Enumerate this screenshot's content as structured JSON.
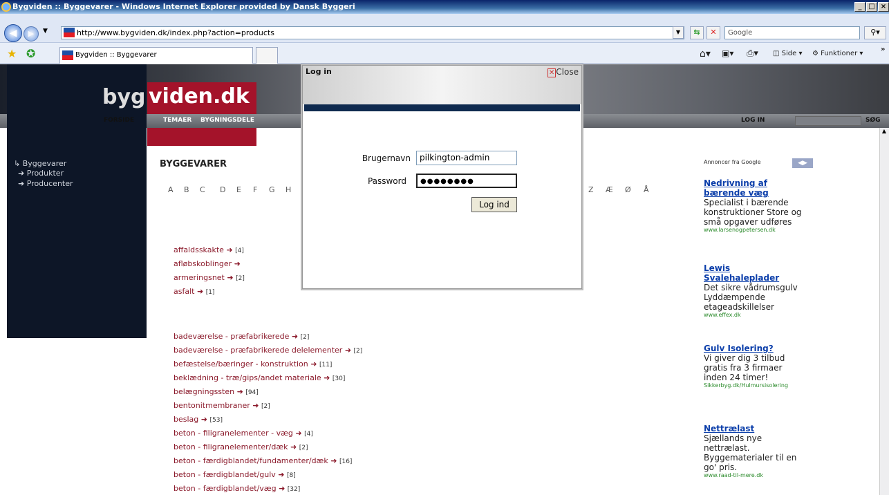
{
  "window": {
    "title": "Bygviden :: Byggevarer - Windows Internet Explorer provided by Dansk Byggeri",
    "min": "_",
    "max": "□",
    "close": "×"
  },
  "addressbar": {
    "url": "http://www.bygviden.dk/index.php?action=products",
    "search_placeholder": "Google"
  },
  "tab": {
    "label": "Bygviden :: Byggevarer"
  },
  "toolbar": {
    "side": "Side",
    "funktioner": "Funktioner",
    "more": "»"
  },
  "site": {
    "logo_left": "byg",
    "logo_right": "viden.dk",
    "nav": [
      "FORSIDE",
      "TEMAER",
      "BYGNINGSDELE"
    ],
    "login": "LOG IN",
    "search": "SØG"
  },
  "sidebar": {
    "items": [
      "Byggevarer",
      "Produkter",
      "Producenter"
    ]
  },
  "main": {
    "title": "BYGGEVARER",
    "alphabet_left": [
      "A",
      "B",
      "C",
      "D",
      "E",
      "F",
      "G",
      "H"
    ],
    "alphabet_right": [
      "Z",
      "Æ",
      "Ø",
      "Å"
    ],
    "group_a": [
      {
        "name": "affaldsskakte",
        "count": "[4]"
      },
      {
        "name": "afløbskoblinger",
        "count": ""
      },
      {
        "name": "armeringsnet",
        "count": "[2]"
      },
      {
        "name": "asfalt",
        "count": "[1]"
      }
    ],
    "group_b": [
      {
        "name": "badeværelse - præfabrikerede",
        "count": "[2]"
      },
      {
        "name": "badeværelse - præfabrikerede delelementer",
        "count": "[2]"
      },
      {
        "name": "befæstelse/bæringer - konstruktion",
        "count": "[11]"
      },
      {
        "name": "beklædning - træ/gips/andet materiale",
        "count": "[30]"
      },
      {
        "name": "belægningssten",
        "count": "[94]"
      },
      {
        "name": "bentonitmembraner",
        "count": "[2]"
      },
      {
        "name": "beslag",
        "count": "[53]"
      },
      {
        "name": "beton - filigranelementer - væg",
        "count": "[4]"
      },
      {
        "name": "beton - filigranelementer/dæk",
        "count": "[2]"
      },
      {
        "name": "beton - færdigblandet/fundamenter/dæk",
        "count": "[16]"
      },
      {
        "name": "beton - færdigblandet/gulv",
        "count": "[8]"
      },
      {
        "name": "beton - færdigblandet/væg",
        "count": "[32]"
      }
    ]
  },
  "ads": {
    "label": "Annoncer fra Google",
    "items": [
      {
        "title": "Nedrivning af bærende væg",
        "text": "Specialist i bærende konstruktioner Store og små opgaver udføres",
        "url": "www.larsenogpetersen.dk"
      },
      {
        "title": "Lewis Svalehaleplader",
        "text": "Det sikre vådrumsgulv Lyddæmpende etageadskillelser",
        "url": "www.effex.dk"
      },
      {
        "title": "Gulv Isolering?",
        "text": "Vi giver dig 3 tilbud gratis fra 3 firmaer inden 24 timer!",
        "url": "Sikkerbyg.dk/Hulmursisolering"
      },
      {
        "title": "Nettrælast",
        "text": "Sjællands nye nettrælast. Byggematerialer til en go' pris.",
        "url": "www.raad-til-mere.dk"
      }
    ]
  },
  "dialog": {
    "title": "Log in",
    "close": "Close",
    "username_label": "Brugernavn",
    "username_value": "pilkington-admin",
    "password_label": "Password",
    "password_value": "●●●●●●●●",
    "submit": "Log ind"
  }
}
